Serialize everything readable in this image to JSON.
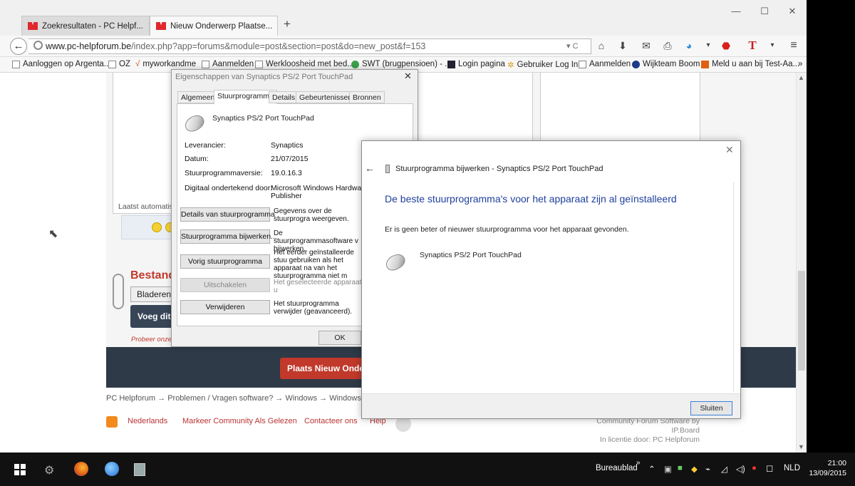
{
  "browser": {
    "tabs": [
      {
        "label": "Zoekresultaten - PC Helpf..."
      },
      {
        "label": "Nieuw Onderwerp Plaatse..."
      }
    ],
    "url_domain": "www.pc-helpforum.be",
    "url_path": "/index.php?app=forums&module=post&section=post&do=new_post&f=153",
    "bookmarks": [
      "Aanloggen op Argenta...",
      "OZ",
      "myworkandme",
      "Aanmelden",
      "Werkloosheid met bed...",
      "SWT (brugpensioen) - ...",
      "Login pagina",
      "Gebruiker Log In",
      "Aanmelden",
      "Wijkteam Boom",
      "Meld u aan bij Test-Aa..."
    ],
    "bookmarks_more": "»"
  },
  "page": {
    "autosave": "Laatst automatisch",
    "attach_title": "Bestand",
    "browse_label": "Bladeren...",
    "add_file_label": "Voeg dit",
    "hint": "Probeer onze g",
    "post_button": "Plaats Nieuw Onde",
    "breadcrumb": "PC Helpforum  →  Problemen / Vragen software?  →  Windows  →  Windows",
    "footer_links": [
      "Nederlands",
      "Markeer Community Als Gelezen",
      "Contacteer ons",
      "Help"
    ],
    "credits_line1": "Community Forum Software by IP.Board",
    "credits_line2": "In licentie door: PC Helpforum"
  },
  "properties_dialog": {
    "title": "Eigenschappen van Synaptics PS/2 Port TouchPad",
    "tabs": [
      "Algemeen",
      "Stuurprogramma",
      "Details",
      "Gebeurtenissen",
      "Bronnen"
    ],
    "device_name": "Synaptics PS/2 Port TouchPad",
    "fields": [
      {
        "label": "Leverancier:",
        "value": "Synaptics"
      },
      {
        "label": "Datum:",
        "value": "21/07/2015"
      },
      {
        "label": "Stuurprogrammaversie:",
        "value": "19.0.16.3"
      },
      {
        "label": "Digitaal ondertekend door:",
        "value": "Microsoft Windows Hardware C"
      }
    ],
    "signer_line2": "Publisher",
    "buttons": [
      {
        "label": "Details van stuurprogramma",
        "desc": "Gegevens over de stuurprogra weergeven."
      },
      {
        "label": "Stuurprogramma bijwerken...",
        "desc": "De stuurprogrammasoftware v bijwerken."
      },
      {
        "label": "Vorig stuurprogramma",
        "desc": "Het eerder geïnstalleerde stuu gebruiken als het apparaat na van het stuurprogramma niet m"
      },
      {
        "label": "Uitschakelen",
        "desc": "Het geselecteerde apparaat u"
      },
      {
        "label": "Verwijderen",
        "desc": "Het stuurprogramma verwijder (geavanceerd)."
      }
    ],
    "ok_label": "OK"
  },
  "update_dialog": {
    "title": "Stuurprogramma bijwerken - Synaptics PS/2 Port TouchPad",
    "heading": "De beste stuurprogramma's voor het apparaat zijn al geïnstalleerd",
    "message": "Er is geen beter of nieuwer stuurprogramma voor het apparaat gevonden.",
    "device": "Synaptics PS/2 Port TouchPad",
    "close_label": "Sluiten"
  },
  "taskbar": {
    "desktop_label": "Bureaublad",
    "language": "NLD",
    "time": "21:00",
    "date": "13/09/2015"
  }
}
